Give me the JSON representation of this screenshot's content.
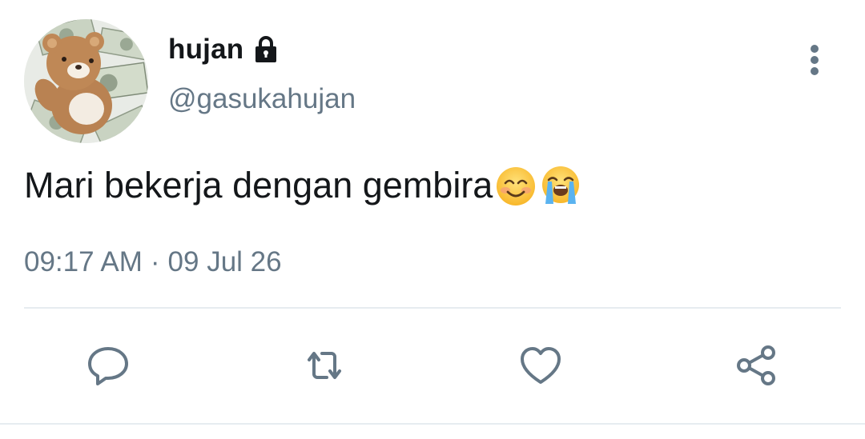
{
  "tweet": {
    "display_name": "hujan",
    "handle": "@gasukahujan",
    "text": "Mari bekerja dengan gembira",
    "emojis": [
      "smiling-face-emoji",
      "loudly-crying-face-emoji"
    ],
    "time": "09:17 AM",
    "separator": "·",
    "date": "09 Jul 26",
    "protected": true
  },
  "icons": {
    "lock": "lock-icon",
    "more": "more-vertical-icon",
    "reply": "reply-icon",
    "retweet": "retweet-icon",
    "like": "heart-icon",
    "share": "share-icon"
  },
  "colors": {
    "primary_text": "#14171a",
    "secondary_text": "#657786",
    "divider": "#e6ecf0"
  }
}
